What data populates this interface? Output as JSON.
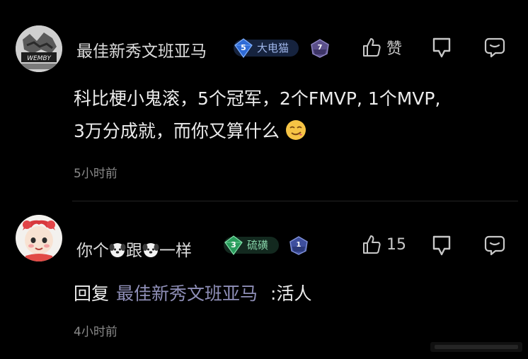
{
  "comments": [
    {
      "username": "最佳新秀文班亚马",
      "badge": {
        "level": "5",
        "name": "大电猫",
        "color": "#2f6bd6"
      },
      "rank_level": "7",
      "like_label": "赞",
      "text_line1": "科比梗小鬼滚，5个冠军，2个FMVP, 1个MVP,",
      "text_line2": "3万分成就，而你又算什么",
      "timestamp": "5小时前",
      "avatar_icon": "player-avatar-icon",
      "emoji_icon": "smirk-emoji-icon"
    },
    {
      "username_parts": [
        "你个",
        "跟",
        "一样"
      ],
      "badge": {
        "level": "3",
        "name": "硫磺",
        "color": "#2a9c5c"
      },
      "rank_level": "1",
      "like_label": "15",
      "reply_prefix": "回复",
      "reply_target": "最佳新秀文班亚马",
      "reply_text": ":活人",
      "timestamp": "4小时前",
      "avatar_icon": "cartoon-girl-avatar-icon",
      "inline_icon": "dog-emoji-icon"
    }
  ]
}
